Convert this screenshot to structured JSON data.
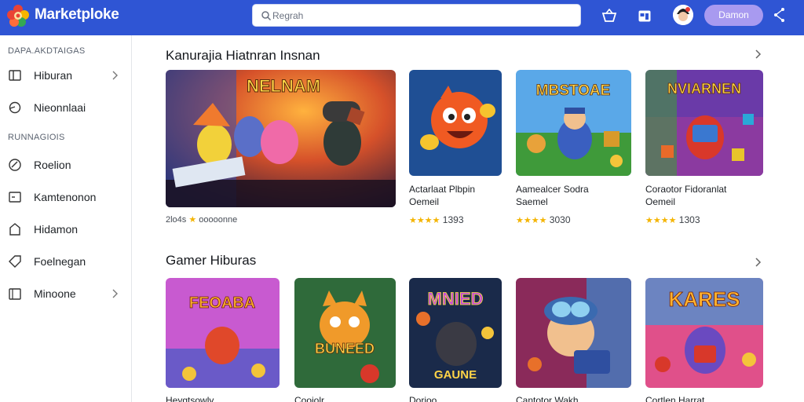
{
  "header": {
    "brand": "Marketploke",
    "search_placeholder": "Regrah",
    "cta_label": "Damon",
    "brand_color": "#2f55d4"
  },
  "sidebar": {
    "section1_title": "DAPA.AKDTAIGAS",
    "section2_title": "RUNNAGIOIS",
    "items": [
      {
        "label": "Hiburan",
        "icon": "columns-icon"
      },
      {
        "label": "Nieonnlaai",
        "icon": "circle-icon"
      },
      {
        "label": "Roelion",
        "icon": "tag-icon"
      },
      {
        "label": "Kamtenonon",
        "icon": "monitor-icon"
      },
      {
        "label": "Hidamon",
        "icon": "bag-icon"
      },
      {
        "label": "Foelnegan",
        "icon": "tag-outline-icon"
      },
      {
        "label": "Minoone",
        "icon": "frame-icon"
      }
    ]
  },
  "featured_section": {
    "title": "Kanurajia Hiatnran Insnan",
    "hero": {
      "image_text": "NELNAM",
      "meta_prefix": "2lo4s",
      "meta_suffix": "ooooonne"
    },
    "cards": [
      {
        "title_line1": "Actarlaat Plbpin",
        "title_line2": "Oemeil",
        "stars": "★★★★",
        "count": "1393"
      },
      {
        "title_line1": "Aamealcer Sodra",
        "title_line2": "Saemel",
        "stars": "★★★★",
        "count": "3030",
        "image_text": "MBSTOAE"
      },
      {
        "title_line1": "Coraotor Fidoranlat",
        "title_line2": "Oemeil",
        "stars": "★★★★",
        "count": "1303",
        "image_text": "NVIARNEN"
      }
    ]
  },
  "games_section": {
    "title": "Gamer Hiburas",
    "cards": [
      {
        "image_text": "FEOABA",
        "title": "Heygtsowly"
      },
      {
        "image_text": "BUNEED",
        "title": "Cooiolr"
      },
      {
        "image_text": "MNIED",
        "image_subtext": "GAUNE",
        "title": "Dorioo"
      },
      {
        "image_text": "",
        "title": "Cantotor Wakh"
      },
      {
        "image_text": "KARES",
        "title": "Cortlen Harrat"
      }
    ]
  }
}
